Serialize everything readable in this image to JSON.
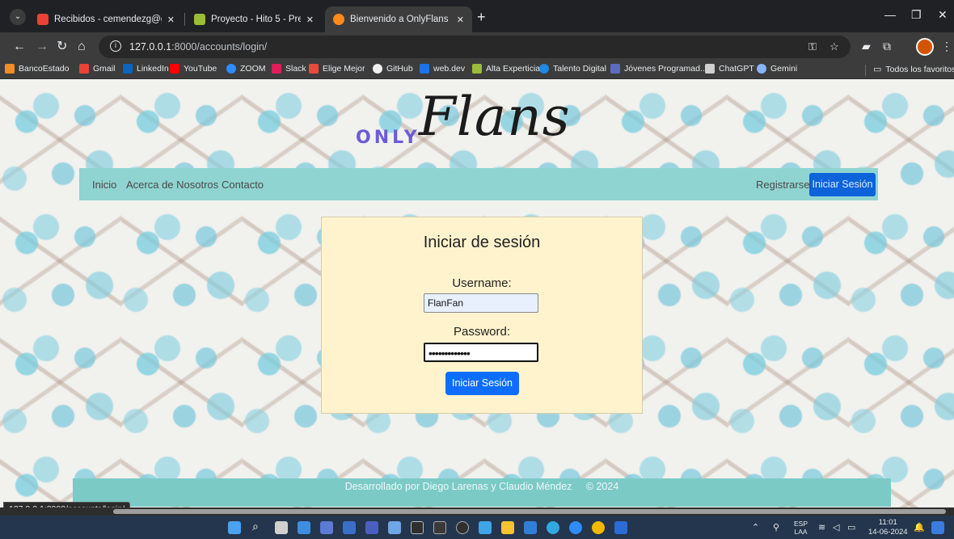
{
  "tabs": [
    {
      "title": "Recibidos - cemendezg@gmail",
      "favicon_color": "#ea4335"
    },
    {
      "title": "Proyecto - Hito 5 - Presentació",
      "favicon_color": "#9bbb3a"
    },
    {
      "title": "Bienvenido a OnlyFlans",
      "favicon_color": "#ff8a1a"
    }
  ],
  "address": {
    "host": "127.0.0.1",
    "path": ":8000/accounts/login/"
  },
  "bookmarks": [
    {
      "label": "BancoEstado",
      "color": "#f28c28"
    },
    {
      "label": "Gmail",
      "color": "#ea4335"
    },
    {
      "label": "LinkedIn",
      "color": "#0a66c2"
    },
    {
      "label": "YouTube",
      "color": "#ff0000"
    },
    {
      "label": "ZOOM",
      "color": "#2d8cff"
    },
    {
      "label": "Slack",
      "color": "#e01e5a"
    },
    {
      "label": "Elige Mejor",
      "color": "#e84b3c"
    },
    {
      "label": "GitHub",
      "color": "#f0f0f0"
    },
    {
      "label": "web.dev",
      "color": "#1a73e8"
    },
    {
      "label": "Alta Experticia",
      "color": "#9bbb3a"
    },
    {
      "label": "Talento Digital",
      "color": "#1e88e5"
    },
    {
      "label": "Jóvenes Programad...",
      "color": "#5c6bc0"
    },
    {
      "label": "ChatGPT",
      "color": "#d0d0d0"
    },
    {
      "label": "Gemini",
      "color": "#8ab4f8"
    }
  ],
  "bookmarks_folder": "Todos los favoritos",
  "brand": {
    "prefix": "ONLY",
    "name": "Flans"
  },
  "nav": {
    "home": "Inicio",
    "about": "Acerca de Nosotros",
    "contact": "Contacto",
    "register": "Registrarse",
    "login": "Iniciar Sesión"
  },
  "login_form": {
    "title": "Iniciar de sesión",
    "username_label": "Username:",
    "username_value": "FlanFan",
    "password_label": "Password:",
    "password_value": "•••••••••••••",
    "submit": "Iniciar Sesión"
  },
  "footer": {
    "text": "Desarrollado por Diego Larenas y Claudio Méndez     © 2024"
  },
  "status_url": "127.0.0.1:8000/accounts/login/",
  "taskbar": {
    "lang": "ESP",
    "lang2": "LAA",
    "time": "11:01",
    "date": "14-06-2024"
  }
}
